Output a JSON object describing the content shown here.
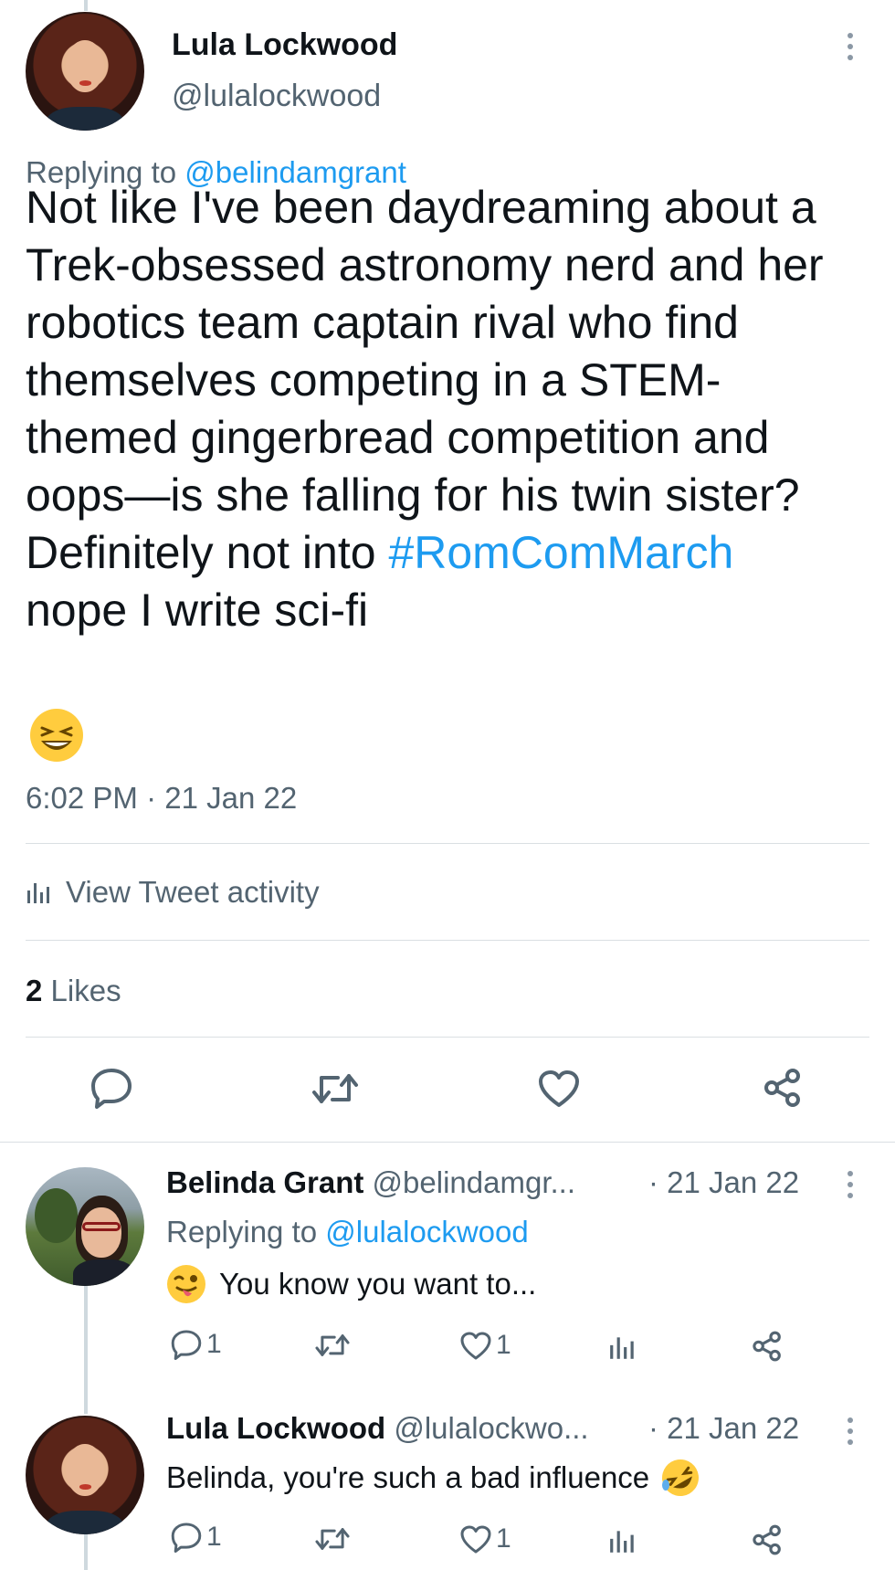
{
  "main_tweet": {
    "author_name": "Lula Lockwood",
    "author_handle": "@lulalockwood",
    "replying_prefix": "Replying to",
    "replying_to": "@belindamgrant",
    "text_before": "Not like I've been daydreaming about a Trek-obsessed astronomy nerd and her robotics team captain rival who find themselves competing in a STEM-themed gingerbread competition and oops—is she falling for his twin sister? Definitely not into",
    "hashtag": "#RomComMarch",
    "text_after": "nope I write sci-fi",
    "emoji": "😆",
    "timestamp": "6:02 PM · 21 Jan 22",
    "activity_label": "View Tweet activity",
    "likes_count": "2",
    "likes_label": "Likes",
    "actions": [
      "reply-icon",
      "retweet-icon",
      "like-icon",
      "share-icon"
    ]
  },
  "replies": [
    {
      "author_name": "Belinda Grant",
      "author_handle": "@belindamgr...",
      "date": "· 21 Jan 22",
      "replying_prefix": "Replying to",
      "replying_to": "@lulalockwood",
      "emoji": "😜",
      "text": "You know you want to...",
      "reply_count": "1",
      "like_count": "1"
    },
    {
      "author_name": "Lula Lockwood",
      "author_handle": "@lulalockwo...",
      "date": "· 21 Jan 22",
      "text": "Belinda, you're such a bad influence",
      "emoji": "🤣",
      "reply_count": "1",
      "like_count": "1"
    }
  ],
  "colors": {
    "link": "#1d9bf0",
    "muted": "#536471",
    "text": "#0f1419",
    "divider": "#dadfe3"
  }
}
